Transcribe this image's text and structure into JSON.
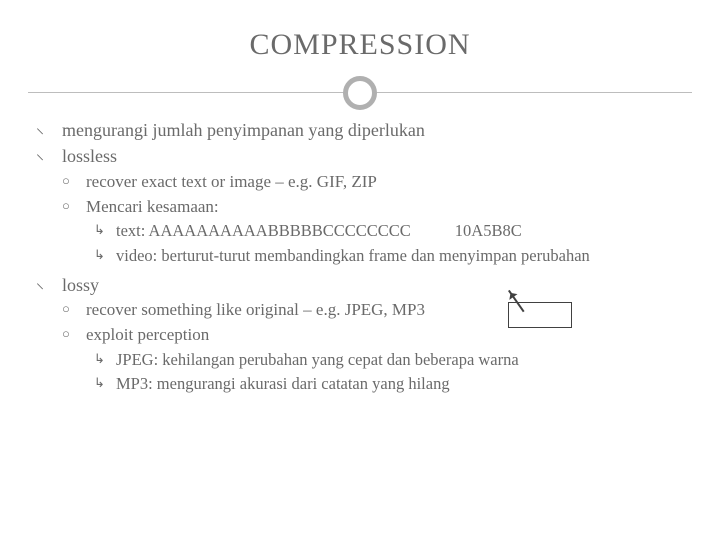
{
  "title": "COMPRESSION",
  "items": {
    "l1a": "mengurangi jumlah penyimpanan yang diperlukan",
    "l1b": "lossless",
    "l2a": "recover exact text or image – e.g. GIF, ZIP",
    "l2b": "Mencari kesamaan:",
    "l3a_text": "text: AAAAAAAAAABBBBBCCCCCCCC",
    "l3a_code": "10A5B8C",
    "l3b": "video:  berturut-turut membandingkan frame dan menyimpan perubahan",
    "l1c": "lossy",
    "l2c": "recover something like original – e.g. JPEG, MP3",
    "l2d": "exploit perception",
    "l3c": "JPEG: kehilangan perubahan yang cepat dan beberapa warna",
    "l3d": "MP3: mengurangi akurasi dari catatan yang hilang"
  },
  "bullets": {
    "b1": "⸜",
    "b2": "○",
    "b3": "↳"
  }
}
